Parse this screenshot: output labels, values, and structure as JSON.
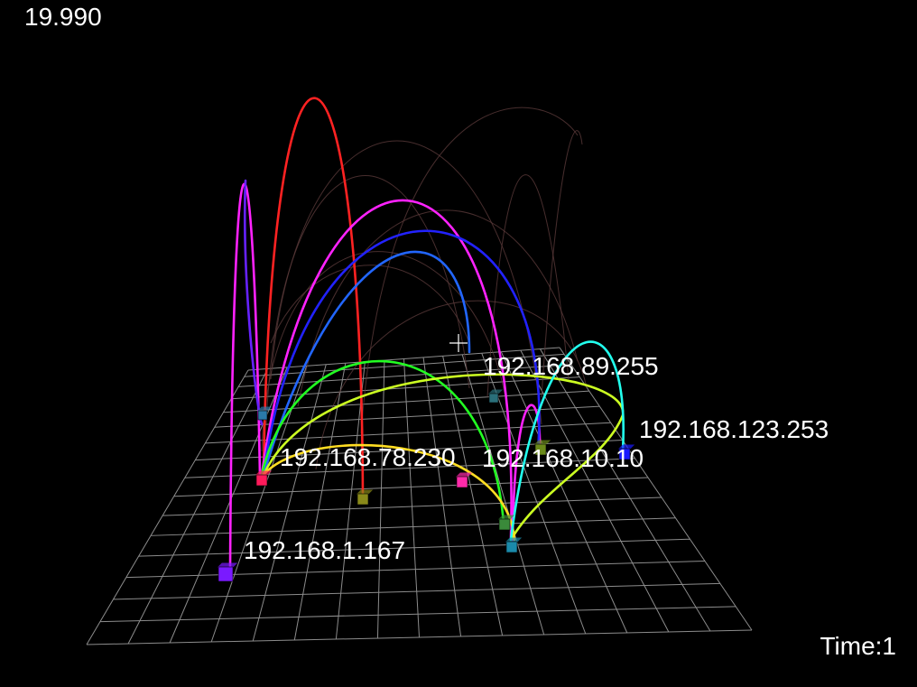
{
  "hud": {
    "fps": "19.990",
    "time": "Time:1"
  },
  "colors": {
    "background": "#000000",
    "grid": "#8c8c8c",
    "label": "#ffffff",
    "ghost_arc": "#5a3a3a"
  },
  "hosts": [
    {
      "id": "h1",
      "label": "192.168.89.255",
      "color": "#2a6f7a"
    },
    {
      "id": "h2",
      "label": "192.168.123.253",
      "color": "#1a1aff"
    },
    {
      "id": "h3",
      "label": "192.168.78.230",
      "color": "#ff1a5a"
    },
    {
      "id": "h4",
      "label": "192.168.10.10",
      "color": "#6a8a1a"
    },
    {
      "id": "h5",
      "label": "192.168.1.167",
      "color": "#7a1aff"
    },
    {
      "id": "h6",
      "label": "",
      "color": "#8a8a1a"
    },
    {
      "id": "h7",
      "label": "",
      "color": "#ff2aaa"
    },
    {
      "id": "h8",
      "label": "",
      "color": "#1a8aaa"
    },
    {
      "id": "h9",
      "label": "",
      "color": "#3a8a3a"
    },
    {
      "id": "h10",
      "label": "",
      "color": "#2a7aaa"
    }
  ],
  "connections": [
    {
      "color": "#ff2222"
    },
    {
      "color": "#ff22ff"
    },
    {
      "color": "#ff22ff"
    },
    {
      "color": "#ff22ff"
    },
    {
      "color": "#2222ff"
    },
    {
      "color": "#2266ff"
    },
    {
      "color": "#6622ff"
    },
    {
      "color": "#22ff22"
    },
    {
      "color": "#ccff22"
    },
    {
      "color": "#ffdd22"
    },
    {
      "color": "#22ffee"
    }
  ]
}
